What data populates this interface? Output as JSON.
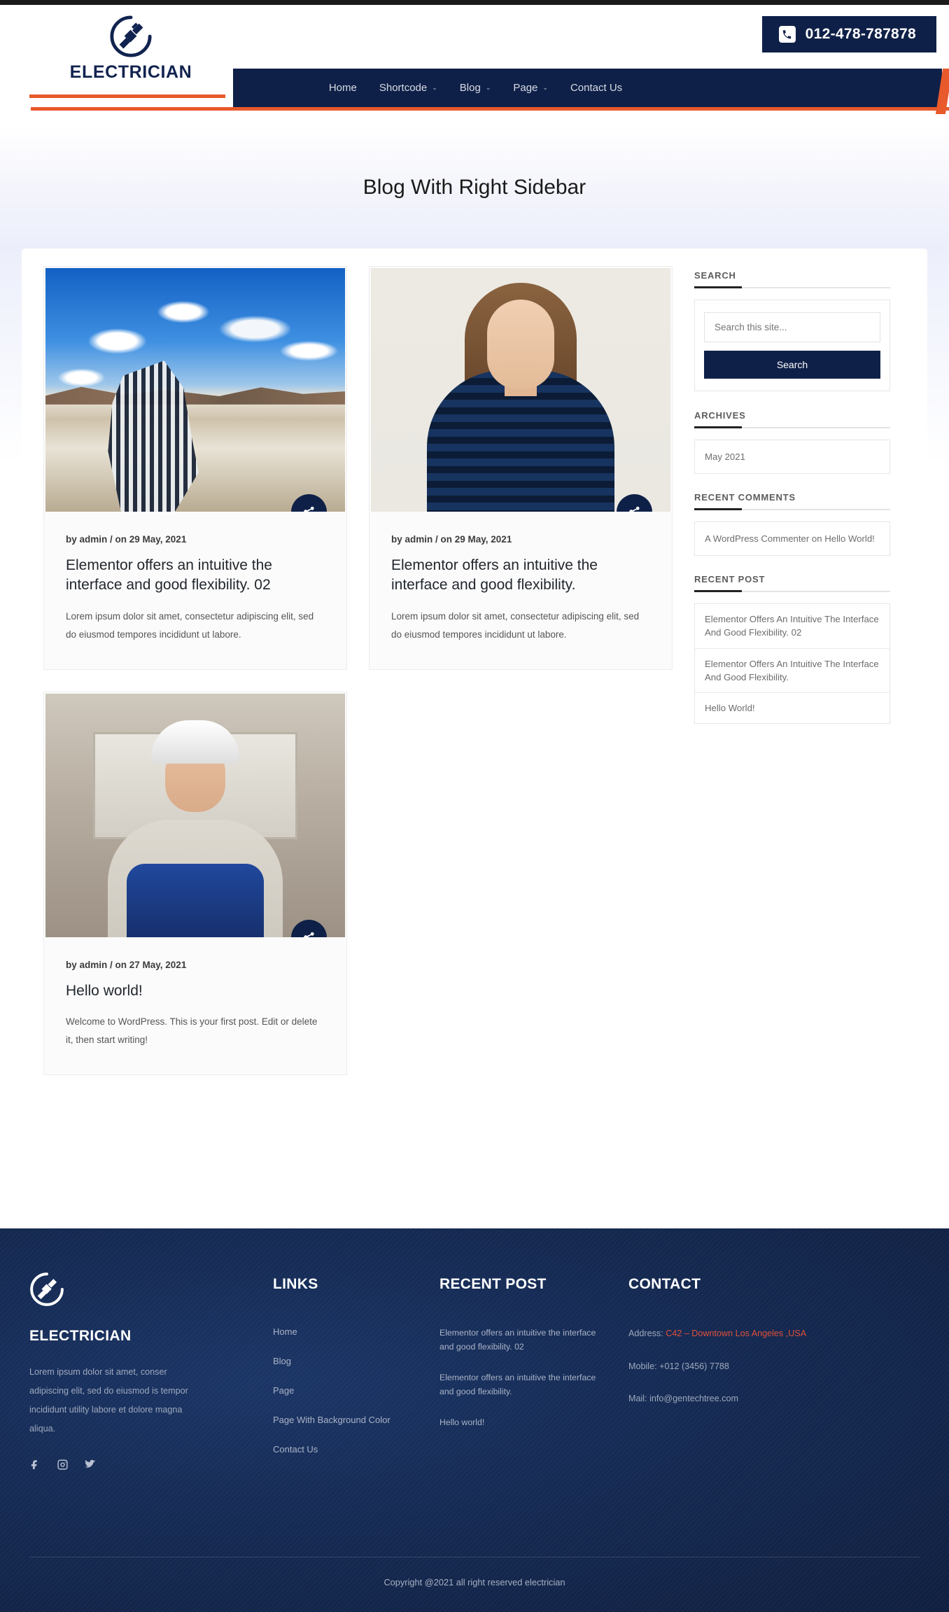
{
  "header": {
    "logo_text": "ELECTRICIAN",
    "logo_icon": "electric-plug-circle-icon",
    "phone": "012-478-787878",
    "phone_icon": "phone-icon",
    "nav": [
      {
        "label": "Home",
        "has_dropdown": false
      },
      {
        "label": "Shortcode",
        "has_dropdown": true
      },
      {
        "label": "Blog",
        "has_dropdown": true
      },
      {
        "label": "Page",
        "has_dropdown": true
      },
      {
        "label": "Contact Us",
        "has_dropdown": false
      }
    ],
    "caret": "⌄"
  },
  "page": {
    "title": "Blog With Right Sidebar"
  },
  "posts": [
    {
      "meta_by": "by admin / on ",
      "meta_date": "29 May, 2021",
      "title": "Elementor offers an intuitive the interface and good flexibility. 02",
      "excerpt": "Lorem ipsum dolor sit amet, consectetur adipiscing elit, sed do eiusmod tempores incididunt ut labore.",
      "image_alt": "man-sitting-on-bench-outdoors-photo",
      "share_icon": "share-icon"
    },
    {
      "meta_by": "by admin / on ",
      "meta_date": "29 May, 2021",
      "title": "Elementor offers an intuitive the interface and good flexibility.",
      "excerpt": "Lorem ipsum dolor sit amet, consectetur adipiscing elit, sed do eiusmod tempores incididunt ut labore.",
      "image_alt": "smiling-woman-portrait-photo",
      "share_icon": "share-icon"
    },
    {
      "meta_by": "by admin / on ",
      "meta_date": "27 May, 2021",
      "title": "Hello world!",
      "excerpt": "Welcome to WordPress. This is your first post. Edit or delete it, then start writing!",
      "image_alt": "electrician-worker-with-hard-hat-photo",
      "share_icon": "share-icon"
    }
  ],
  "sidebar": {
    "search": {
      "heading": "SEARCH",
      "placeholder": "Search this site...",
      "value": "",
      "button": "Search"
    },
    "archives": {
      "heading": "ARCHIVES",
      "items": [
        "May 2021"
      ]
    },
    "recent_comments": {
      "heading": "RECENT COMMENTS",
      "items": [
        "A WordPress Commenter on Hello World!"
      ]
    },
    "recent_post": {
      "heading": "RECENT POST",
      "items": [
        "Elementor Offers An Intuitive The Interface And Good Flexibility. 02",
        "Elementor Offers An Intuitive The Interface And Good Flexibility.",
        "Hello World!"
      ]
    }
  },
  "footer": {
    "brand": {
      "logo_icon": "electric-plug-circle-icon",
      "name": "ELECTRICIAN",
      "about": "Lorem ipsum dolor sit amet, conser adipiscing elit, sed do eiusmod is tempor incididunt utility labore et dolore magna aliqua.",
      "social": [
        "facebook-icon",
        "instagram-icon",
        "twitter-icon"
      ]
    },
    "links": {
      "heading": "LINKS",
      "items": [
        "Home",
        "Blog",
        "Page",
        "Page With Background Color",
        "Contact Us"
      ]
    },
    "recent_post": {
      "heading": "RECENT POST",
      "items": [
        "Elementor offers an intuitive the interface and good flexibility. 02",
        "Elementor offers an intuitive the interface and good flexibility.",
        "Hello world!"
      ]
    },
    "contact": {
      "heading": "CONTACT",
      "address_label": "Address: ",
      "address_value": "C42 – Downtown Los Angeles ,USA",
      "mobile": "Mobile: +012 (3456) 7788",
      "mail": "Mail: info@gentechtree.com"
    },
    "copyright": "Copyright @2021 all right reserved electrician"
  },
  "colors": {
    "navy": "#0f2048",
    "orange": "#e8592b",
    "accent_red": "#e0503a"
  }
}
